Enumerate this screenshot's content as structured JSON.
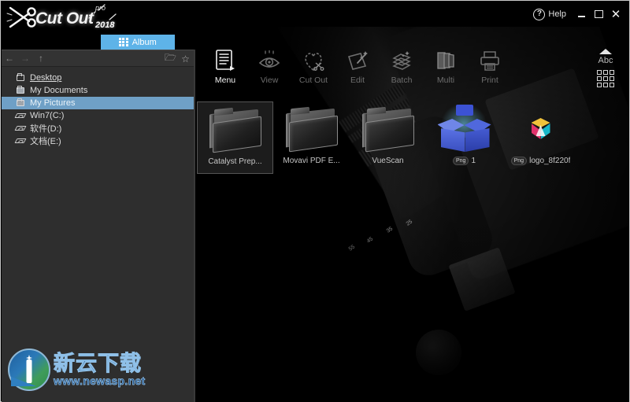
{
  "app": {
    "logo_name": "Cut Out",
    "logo_edition": "pro",
    "logo_year": "2018",
    "accent_color": "#5eb3e8",
    "selection_color": "#6fa0c6"
  },
  "titlebar": {
    "help_icon": "question-circle-icon",
    "help_label": "Help",
    "minimize_label": "–",
    "maximize_label": "□",
    "close_label": "✕"
  },
  "tabs": [
    {
      "label": "Album",
      "icon": "grid-icon",
      "active": true
    }
  ],
  "sidebar": {
    "nav": {
      "back_icon": "arrow-left-icon",
      "forward_icon": "arrow-right-icon",
      "up_icon": "arrow-up-icon",
      "new_folder_icon": "new-folder-icon",
      "favorite_icon": "star-icon"
    },
    "tree": [
      {
        "label": "Desktop",
        "icon": "folder-icon",
        "selected": false
      },
      {
        "label": "My Documents",
        "icon": "folder-filled-icon",
        "selected": false
      },
      {
        "label": "My Pictures",
        "icon": "folder-filled-icon",
        "selected": true
      },
      {
        "label": "Win7(C:)",
        "icon": "disk-icon",
        "selected": false
      },
      {
        "label": "软件(D:)",
        "icon": "disk-icon",
        "selected": false
      },
      {
        "label": "文档(E:)",
        "icon": "disk-icon",
        "selected": false
      }
    ]
  },
  "watermark": {
    "title_cn": "新云下载",
    "url": "www.newasp.net"
  },
  "toolbar": {
    "items": [
      {
        "label": "Menu",
        "icon": "menu-document-icon",
        "active": true
      },
      {
        "label": "View",
        "icon": "eye-icon",
        "active": false
      },
      {
        "label": "Cut Out",
        "icon": "heart-scissors-icon",
        "active": false
      },
      {
        "label": "Edit",
        "icon": "edit-wand-icon",
        "active": false
      },
      {
        "label": "Batch",
        "icon": "batch-stack-icon",
        "active": false
      },
      {
        "label": "Multi",
        "icon": "multi-pages-icon",
        "active": false
      },
      {
        "label": "Print",
        "icon": "printer-icon",
        "active": false
      }
    ]
  },
  "view_options": {
    "sort_arrow_icon": "triangle-up-icon",
    "sort_label": "Abc",
    "grid_icon": "thumbnail-grid-icon"
  },
  "thumbnails": [
    {
      "label": "Catalyst Prep...",
      "kind": "folder",
      "format": "",
      "selected": true
    },
    {
      "label": "Movavi PDF E...",
      "kind": "folder",
      "format": "",
      "selected": false
    },
    {
      "label": "VueScan",
      "kind": "folder",
      "format": "",
      "selected": false
    },
    {
      "label": "1",
      "kind": "image-box",
      "format": "Png",
      "selected": false
    },
    {
      "label": "logo_8f220f",
      "kind": "image-cube",
      "format": "Png",
      "selected": false
    }
  ],
  "background": {
    "description": "dark dslr camera photo",
    "lens_ticks": [
      "55",
      "45",
      "35",
      "25"
    ]
  }
}
